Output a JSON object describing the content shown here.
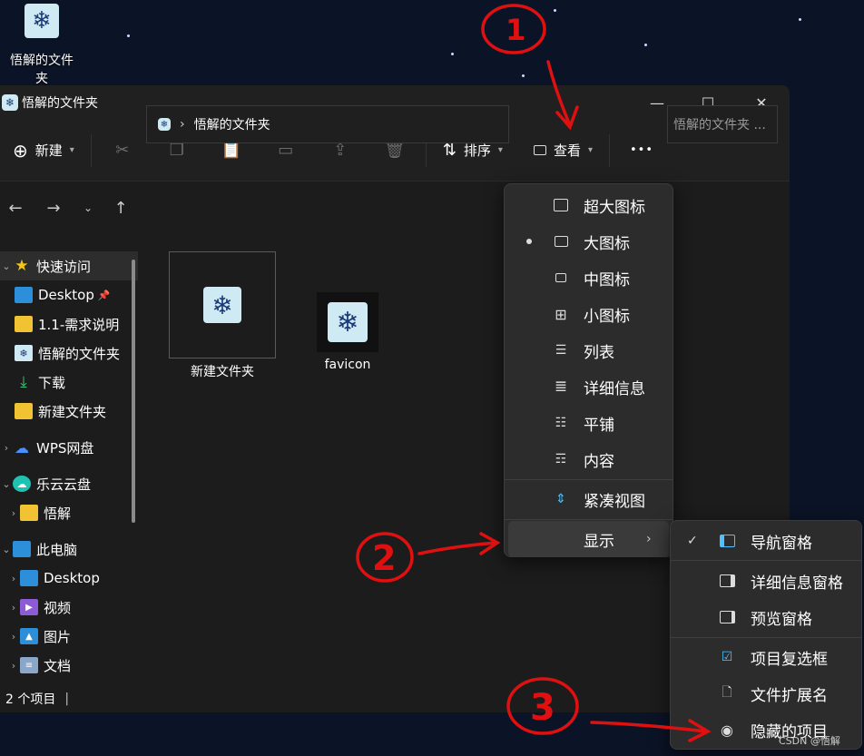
{
  "desktop": {
    "icon_label": "悟解的文件夹"
  },
  "window": {
    "title": "悟解的文件夹",
    "controls": {
      "minimize": "—",
      "maximize": "☐",
      "close": "✕"
    }
  },
  "toolbar": {
    "new_label": "新建",
    "sort_label": "排序",
    "view_label": "查看",
    "more_label": "•••"
  },
  "address": {
    "crumb": "悟解的文件夹",
    "search_placeholder": "悟解的文件夹 ..."
  },
  "sidebar": {
    "items": [
      {
        "label": "快速访问"
      },
      {
        "label": "Desktop"
      },
      {
        "label": "1.1-需求说明"
      },
      {
        "label": "悟解的文件夹"
      },
      {
        "label": "下载"
      },
      {
        "label": "新建文件夹"
      },
      {
        "label": "WPS网盘"
      },
      {
        "label": "乐云云盘"
      },
      {
        "label": "悟解"
      },
      {
        "label": "此电脑"
      },
      {
        "label": "Desktop"
      },
      {
        "label": "视频"
      },
      {
        "label": "图片"
      },
      {
        "label": "文档"
      }
    ]
  },
  "files": [
    {
      "name": "新建文件夹"
    },
    {
      "name": "favicon"
    }
  ],
  "status": {
    "count": "2 个项目"
  },
  "view_menu": {
    "items": [
      {
        "label": "超大图标"
      },
      {
        "label": "大图标"
      },
      {
        "label": "中图标"
      },
      {
        "label": "小图标"
      },
      {
        "label": "列表"
      },
      {
        "label": "详细信息"
      },
      {
        "label": "平铺"
      },
      {
        "label": "内容"
      },
      {
        "label": "紧凑视图"
      },
      {
        "label": "显示"
      }
    ]
  },
  "show_submenu": {
    "items": [
      {
        "label": "导航窗格"
      },
      {
        "label": "详细信息窗格"
      },
      {
        "label": "预览窗格"
      },
      {
        "label": "项目复选框"
      },
      {
        "label": "文件扩展名"
      },
      {
        "label": "隐藏的项目"
      }
    ]
  },
  "annotations": {
    "one": "1",
    "two": "2",
    "three": "3"
  },
  "watermark": "CSDN @悟解",
  "colors": {
    "accent": "#4cc2ff",
    "annotation": "#e01010",
    "menu_bg": "#2c2c2c",
    "window_bg": "#1c1c1c"
  }
}
